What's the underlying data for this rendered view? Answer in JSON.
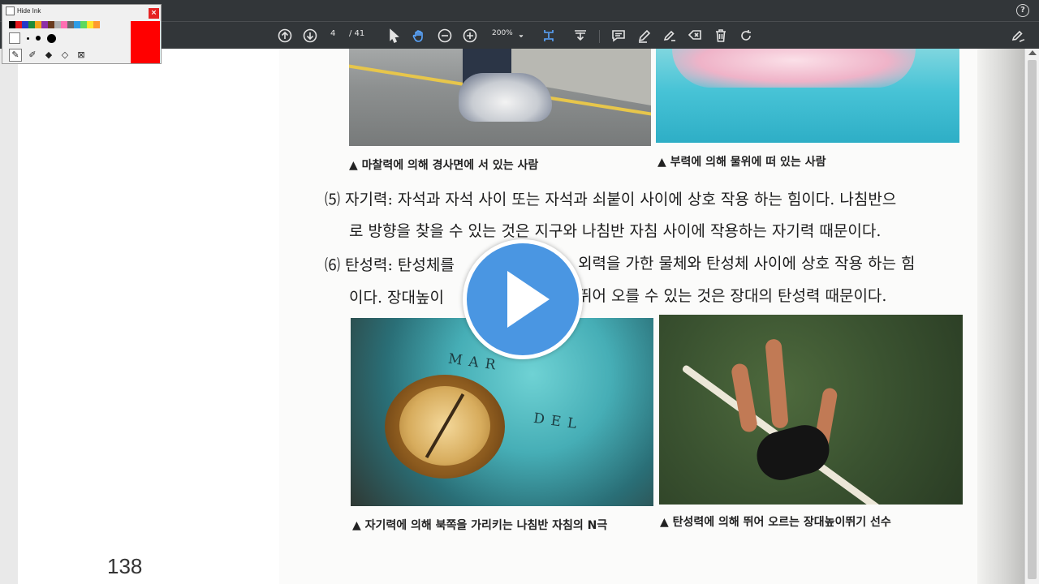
{
  "ink_panel": {
    "hide_label": "Hide Ink",
    "close_label": "×",
    "palette": [
      "#000000",
      "#e4141b",
      "#2639c9",
      "#1f8b3a",
      "#f2a51b",
      "#8c2fa7",
      "#6a3b1e",
      "#b0b0b0",
      "#ff6fb2",
      "#6b6b6b",
      "#2e9de6",
      "#5ed95e",
      "#ffe52a",
      "#ff9a2e"
    ],
    "active_color": "#ff0000"
  },
  "toolbar": {
    "page_current": "4",
    "page_total": "/ 41",
    "zoom": "200%"
  },
  "page": {
    "left_page_number": "138",
    "captions": {
      "friction": "▲ 마찰력에 의해 경사면에 서 있는 사람",
      "buoyancy": "▲ 부력에 의해 물위에 떠 있는 사람",
      "magnetic": "▲ 자기력에 의해 북쪽을 가리키는 나침반 자침의 N극",
      "elastic": "▲ 탄성력에 의해 뛰어 오르는 장대높이뛰기 선수"
    },
    "paragraphs": {
      "p5_line1": "⑸ 자기력: 자석과 자석 사이 또는 자석과 쇠붙이 사이에 상호 작용 하는 힘이다. 나침반으",
      "p5_line2": "로 방향을 찾을 수 있는 것은 지구와 나침반 자침 사이에 작용하는 자기력 때문이다.",
      "p6_line1_a": "⑹ 탄성력: 탄성체를",
      "p6_line1_b": ". 외력을 가한 물체와 탄성체 사이에 상호 작용 하는 힘",
      "p6_line2_a": "이다. 장대높이",
      "p6_line2_b": "뛰어 오를 수 있는 것은 장대의 탄성력 때문이다."
    },
    "map_labels": [
      "MAR",
      "DEL"
    ]
  },
  "help_label": "?"
}
